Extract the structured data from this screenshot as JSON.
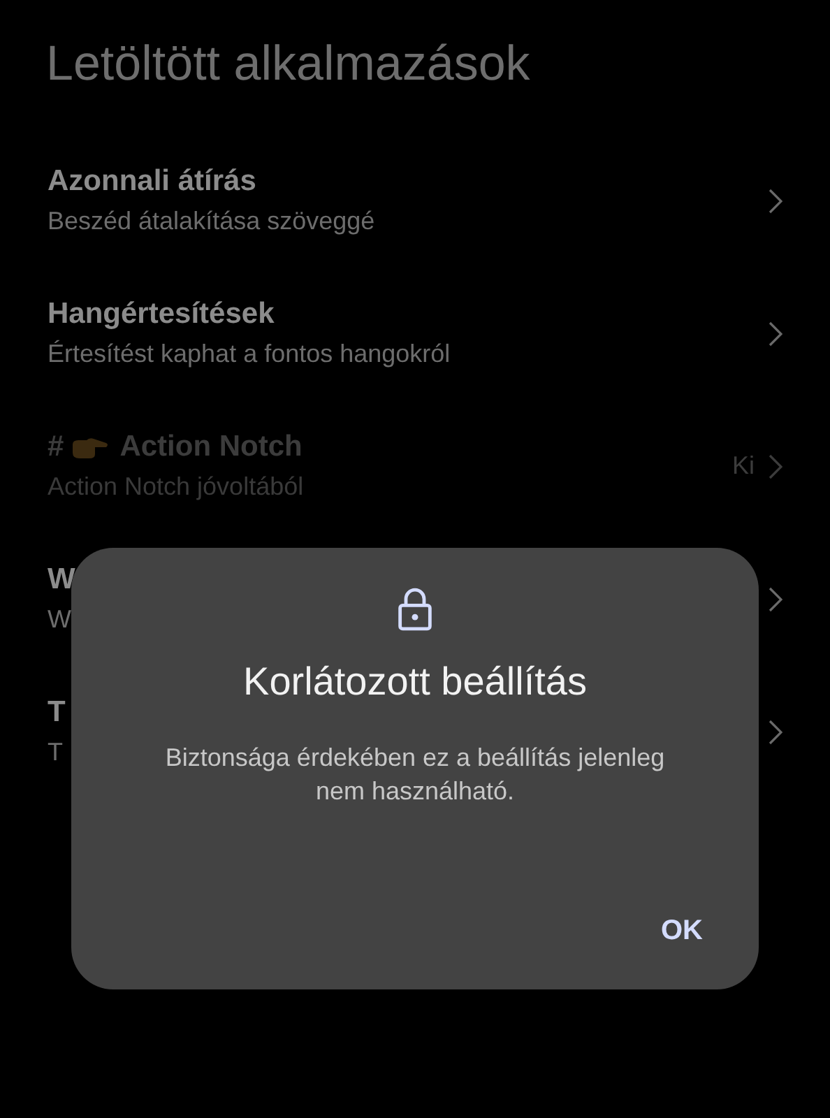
{
  "header": {
    "title": "Letöltött alkalmazások"
  },
  "items": [
    {
      "title": "Azonnali átírás",
      "subtitle": "Beszéd átalakítása szöveggé",
      "disabled": false,
      "kind": "plain"
    },
    {
      "title": "Hangértesítések",
      "subtitle": "Értesítést kaphat a fontos hangokról",
      "disabled": false,
      "kind": "plain"
    },
    {
      "prefix": "#",
      "title": "Action Notch",
      "subtitle": "Action Notch jóvoltából",
      "value": "Ki",
      "disabled": true,
      "kind": "emoji"
    },
    {
      "title": "W",
      "subtitle": "W",
      "disabled": false,
      "kind": "plain"
    },
    {
      "title": "T",
      "subtitle": "T",
      "disabled": false,
      "kind": "plain"
    }
  ],
  "dialog": {
    "title": "Korlátozott beállítás",
    "message": "Biztonsága érdekében ez a beállítás jelenleg nem használható.",
    "button": "OK"
  }
}
